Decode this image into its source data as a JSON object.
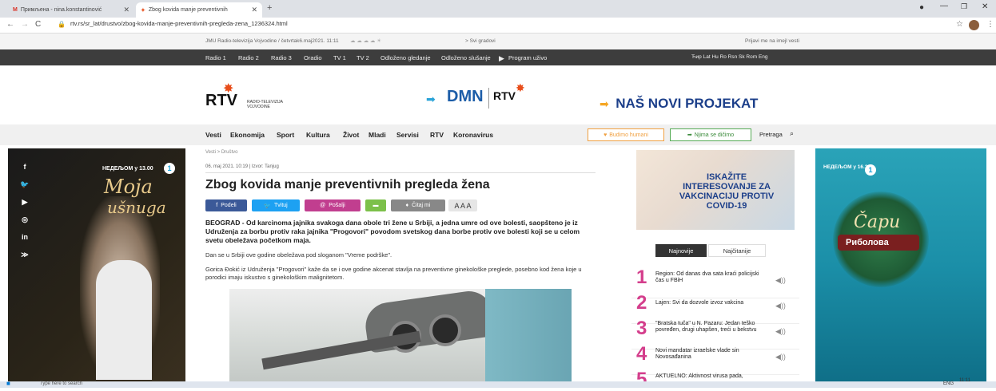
{
  "browser": {
    "tabs": [
      {
        "label": "Примљена - nina.konstantinović"
      },
      {
        "label": "Zbog kovida manje preventivnih"
      }
    ],
    "url": "rtv.rs/sr_lat/drustvo/zbog-kovida-manje-preventivnih-pregleda-zena_1236324.html"
  },
  "infobar": {
    "left_text": "JMU Radio-televizija Vojvodine / četvrtak6.maj2021. 11:11",
    "weather_link": "> Svi gradovi",
    "login": "Prijavi me na imejl vesti"
  },
  "darknav": {
    "items": [
      "Radio 1",
      "Radio 2",
      "Radio 3",
      "Oradio",
      "TV 1",
      "TV 2",
      "Odloženo gledanje",
      "Odloženo slušanje",
      "Program uživo"
    ],
    "languages": "Ћир Lat Hu Ro Rsn Sk Rom Eng"
  },
  "logos": {
    "rtv": "RTV",
    "rtv_sub": "RADIO-TELEVIZIJA VOJVODINE",
    "dmn": "DMN",
    "dmn_rtv": "RTV",
    "project": "NAŠ NOVI PROJEKAT"
  },
  "mainnav": {
    "items": [
      "Vesti",
      "Ekonomija",
      "Sport",
      "Kultura",
      "Život",
      "Mladi",
      "Servisi",
      "RTV",
      "Koronavirus"
    ],
    "humani": "Budimo humani",
    "delimo": "Njima se dičimo",
    "search": "Pretraga"
  },
  "leftad": {
    "line1": "НЕДЕЉОМ у 13.00",
    "title": "Moja",
    "title2": "ušnuga"
  },
  "article": {
    "breadcrumb": "Vesti > Društvo",
    "meta": "06. maj 2021. 10:19 | Izvor: Tanjug",
    "title": "Zbog kovida manje preventivnih pregleda žena",
    "buttons": [
      "Podeli",
      "Tvituj",
      "Pošalji",
      "",
      "Čitaj mi"
    ],
    "font_sizes": "A A A",
    "lead": "BEOGRAD - Od karcinoma jajnika svakoga dana obole tri žene u Srbiji, a jedna umre od ove bolesti, saopšteno je iz Udruženja za borbu protiv raka jajnika \"Progovori\" povodom svetskog dana borbe protiv ove bolesti koji se u celom svetu obeležava početkom maja.",
    "p1": "Dan se u Srbiji ove godine obeležava pod sloganom \"Vreme podrške\".",
    "p2": "Gorica Đokić iz Udruženja \"Progovori\" kaže da se i ove godine akcenat stavlja na preventivne ginekološke preglede, posebno kod žena koje u porodici imaju iskustvo s ginekološkim malignitetom."
  },
  "sidebar": {
    "ad_text": "ISKAŽITE INTERESOVANJE ZA VAKCINACIJU PROTIV COVID-19",
    "tabs": [
      "Najnovije",
      "Najčitanije"
    ],
    "news": [
      {
        "num": "1",
        "text": "Region: Od danas dva sata kraći policijski čas u FBiH"
      },
      {
        "num": "2",
        "text": "Lajen: Svi da dozvole izvoz vakcina"
      },
      {
        "num": "3",
        "text": "\"Bratska tuča\" u N. Pazaru: Jedan teško povređen, drugi uhapšen, treći u bekstvu"
      },
      {
        "num": "4",
        "text": "Novi mandatar izraelske vlade sin Novosađanina"
      },
      {
        "num": "5",
        "text": "AKTUELNO: Aktivnost virusa pada,"
      }
    ]
  },
  "rightad": {
    "line1": "НЕДЕЉОМ у 16.30",
    "title": "Čaрu",
    "sub": "Риболовa"
  },
  "taskbar": {
    "search": "Type here to search",
    "time": "11:11",
    "lang": "ENG"
  }
}
